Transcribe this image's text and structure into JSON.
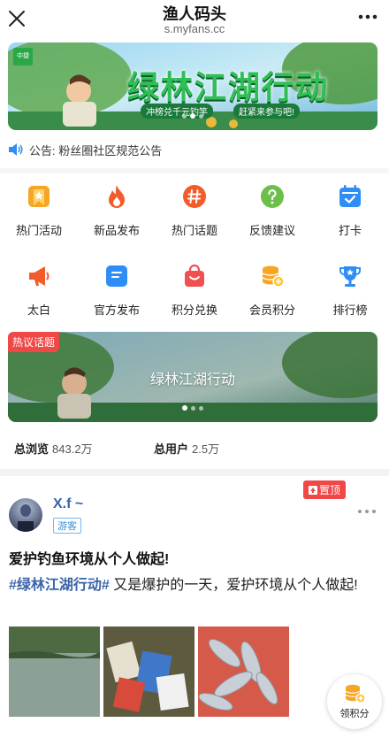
{
  "topbar": {
    "title": "渔人码头",
    "url": "s.myfans.cc"
  },
  "banner1": {
    "headline": "绿林江湖行动",
    "sub1": "冲榜兑千元钓竿",
    "sub2": "赶紧来参与吧!",
    "logo": "中捷"
  },
  "notice": {
    "text": "公告: 粉丝圈社区规范公告"
  },
  "grid": {
    "row1": [
      {
        "label": "热门活动",
        "icon": "star-bookmark-icon",
        "color": "#f6a623"
      },
      {
        "label": "新品发布",
        "icon": "flame-icon",
        "color": "#f45b2a"
      },
      {
        "label": "热门话题",
        "icon": "hashtag-icon",
        "color": "#f45b2a"
      },
      {
        "label": "反馈建议",
        "icon": "question-icon",
        "color": "#6cc04a"
      },
      {
        "label": "打卡",
        "icon": "calendar-check-icon",
        "color": "#2f8ef5"
      }
    ],
    "row2": [
      {
        "label": "太白",
        "icon": "megaphone-icon",
        "color": "#f45b2a"
      },
      {
        "label": "官方发布",
        "icon": "document-icon",
        "color": "#2f8ef5"
      },
      {
        "label": "积分兑换",
        "icon": "shopping-bag-icon",
        "color": "#f05050"
      },
      {
        "label": "会员积分",
        "icon": "coins-icon",
        "color": "#f6a623"
      },
      {
        "label": "排行榜",
        "icon": "trophy-icon",
        "color": "#2f8ef5"
      }
    ]
  },
  "banner2": {
    "tag": "热议话题",
    "caption": "绿林江湖行动"
  },
  "stats": {
    "views_label": "总浏览",
    "views_value": "843.2万",
    "users_label": "总用户",
    "users_value": "2.5万"
  },
  "post": {
    "pin_label": "置顶",
    "username": "X.f ~",
    "role": "游客",
    "title": "爱护钓鱼环境从个人做起!",
    "hashtag": "#绿林江湖行动#",
    "body": " 又是爆护的一天，爱护环境从个人做起!"
  },
  "fab": {
    "label": "领积分"
  },
  "colors": {
    "accent": "#3a64a8",
    "red": "#f04747"
  }
}
